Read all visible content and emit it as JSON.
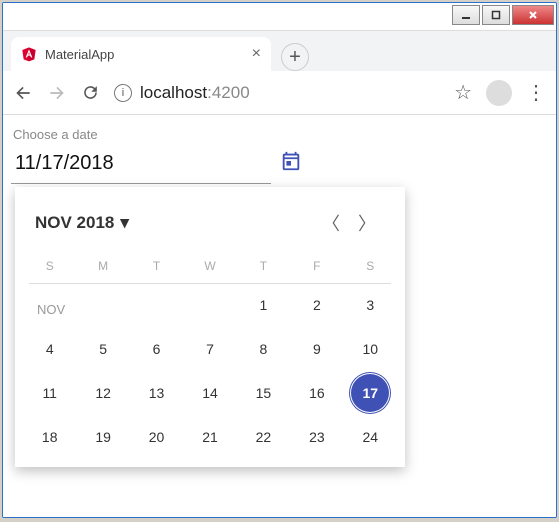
{
  "window": {
    "tab_title": "MaterialApp",
    "url_host": "localhost",
    "url_port": ":4200"
  },
  "field": {
    "label": "Choose a date",
    "value": "11/17/2018"
  },
  "datepicker": {
    "period_label": "NOV 2018",
    "month_abbr": "NOV",
    "days_of_week": [
      "S",
      "M",
      "T",
      "W",
      "T",
      "F",
      "S"
    ],
    "weeks": [
      [
        "",
        "",
        "",
        "",
        "1",
        "2",
        "3"
      ],
      [
        "4",
        "5",
        "6",
        "7",
        "8",
        "9",
        "10"
      ],
      [
        "11",
        "12",
        "13",
        "14",
        "15",
        "16",
        "17"
      ],
      [
        "18",
        "19",
        "20",
        "21",
        "22",
        "23",
        "24"
      ]
    ],
    "selected_day": "17"
  },
  "colors": {
    "primary": "#3f51b5"
  }
}
